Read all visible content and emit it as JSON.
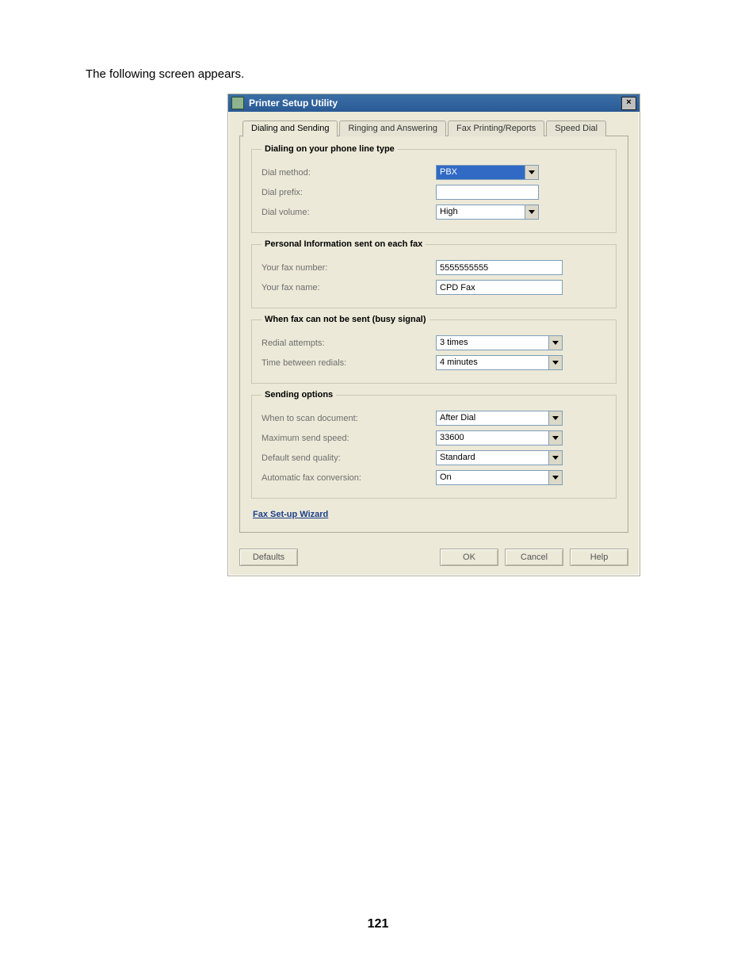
{
  "page": {
    "intro_text": "The following screen appears.",
    "page_number": "121"
  },
  "window": {
    "title": "Printer Setup Utility"
  },
  "tabs": {
    "dialing_sending": "Dialing and Sending",
    "ringing_answering": "Ringing and Answering",
    "fax_printing_reports": "Fax Printing/Reports",
    "speed_dial": "Speed Dial"
  },
  "groups": {
    "dialing": {
      "legend": "Dialing on your phone line type",
      "dial_method_label": "Dial method:",
      "dial_method_value": "PBX",
      "dial_prefix_label": "Dial prefix:",
      "dial_prefix_value": "",
      "dial_volume_label": "Dial volume:",
      "dial_volume_value": "High"
    },
    "personal": {
      "legend": "Personal Information sent on each fax",
      "fax_number_label": "Your fax number:",
      "fax_number_value": "5555555555",
      "fax_name_label": "Your fax name:",
      "fax_name_value": "CPD Fax"
    },
    "busy": {
      "legend": "When fax can not be sent (busy signal)",
      "redial_attempts_label": "Redial attempts:",
      "redial_attempts_value": "3 times",
      "time_between_label": "Time between redials:",
      "time_between_value": "4 minutes"
    },
    "sending": {
      "legend": "Sending options",
      "when_scan_label": "When to scan document:",
      "when_scan_value": "After Dial",
      "max_speed_label": "Maximum send speed:",
      "max_speed_value": "33600",
      "quality_label": "Default send quality:",
      "quality_value": "Standard",
      "auto_conv_label": "Automatic fax conversion:",
      "auto_conv_value": "On"
    }
  },
  "links": {
    "wizard": "Fax Set-up Wizard"
  },
  "buttons": {
    "defaults": "Defaults",
    "ok": "OK",
    "cancel": "Cancel",
    "help": "Help"
  }
}
